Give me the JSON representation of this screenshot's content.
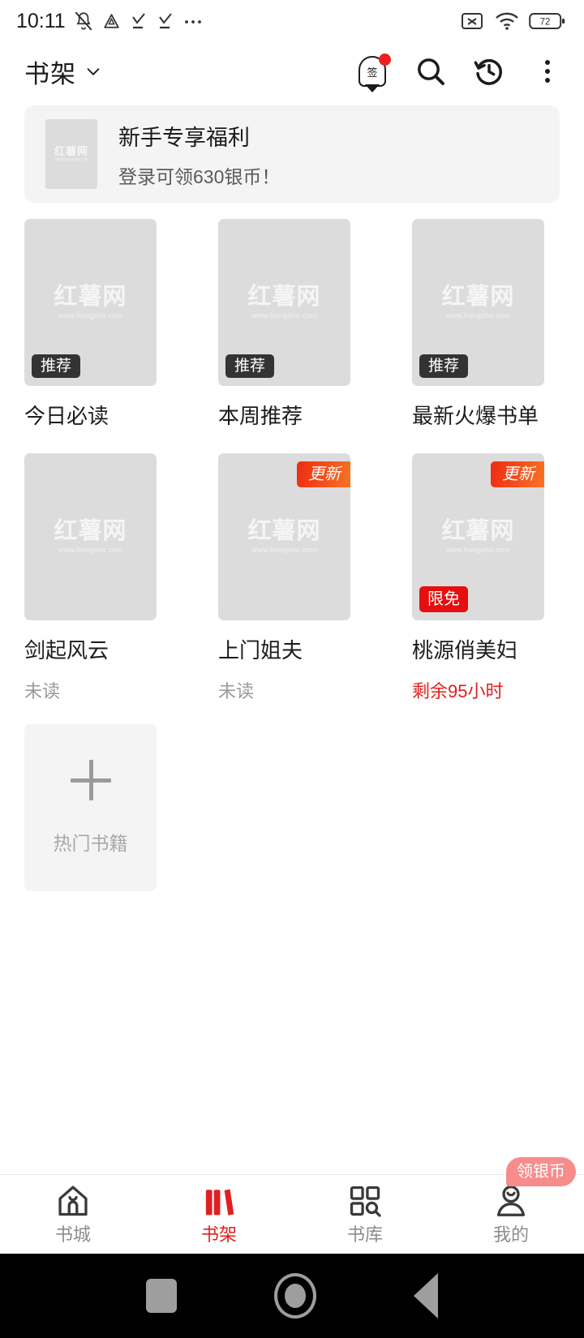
{
  "status_bar": {
    "time": "10:11",
    "battery_percent": "72",
    "icons": [
      "mute-bell-icon",
      "drive-triangle-icon",
      "download-check-icon",
      "download-check-icon",
      "more-dots-icon"
    ],
    "right_icons": [
      "sim-off-icon",
      "wifi-icon",
      "battery-icon"
    ]
  },
  "header": {
    "title": "书架",
    "dropdown_icon": "chevron-down-icon",
    "actions": [
      {
        "name": "sign-in-icon",
        "label": "签",
        "has_dot": true
      },
      {
        "name": "search-icon",
        "label": ""
      },
      {
        "name": "history-icon",
        "label": ""
      },
      {
        "name": "more-menu-icon",
        "label": ""
      }
    ]
  },
  "promo": {
    "title": "新手专享福利",
    "subtitle": "登录可领630银币！",
    "thumb_watermark": {
      "main": "红薯网",
      "url": "www.hongshu.com"
    }
  },
  "watermark": {
    "main": "红薯网",
    "url": "www.hongshu.com"
  },
  "books": [
    {
      "title": "今日必读",
      "status": "",
      "status_type": "none",
      "badge": "推荐",
      "badge_type": "rec",
      "corner": "",
      "cover": "placeholder"
    },
    {
      "title": "本周推荐",
      "status": "",
      "status_type": "none",
      "badge": "推荐",
      "badge_type": "rec",
      "corner": "",
      "cover": "placeholder"
    },
    {
      "title": "最新火爆书单",
      "status": "",
      "status_type": "none",
      "badge": "推荐",
      "badge_type": "rec",
      "corner": "",
      "cover": "placeholder"
    },
    {
      "title": "剑起风云",
      "status": "未读",
      "status_type": "normal",
      "badge": "",
      "badge_type": "none",
      "corner": "",
      "cover": "placeholder"
    },
    {
      "title": "上门姐夫",
      "status": "未读",
      "status_type": "normal",
      "badge": "",
      "badge_type": "none",
      "corner": "更新",
      "cover": "placeholder"
    },
    {
      "title": "桃源俏美妇",
      "status": "剩余95小时",
      "status_type": "warn",
      "badge": "限免",
      "badge_type": "free",
      "corner": "更新",
      "cover": "placeholder"
    }
  ],
  "add_card": {
    "label": "热门书籍",
    "icon": "plus-icon"
  },
  "tabbar": {
    "coin_badge": "领银币",
    "items": [
      {
        "label": "书城",
        "icon": "home-icon",
        "active": false
      },
      {
        "label": "书架",
        "icon": "books-icon",
        "active": true
      },
      {
        "label": "书库",
        "icon": "grid-search-icon",
        "active": false
      },
      {
        "label": "我的",
        "icon": "person-icon",
        "active": false
      }
    ]
  },
  "android_nav": {
    "recents": "square-icon",
    "home": "circle-icon",
    "back": "back-triangle-icon"
  },
  "colors": {
    "accent": "#e02020",
    "badge_dark": "#333333",
    "muted": "#9a9a9a",
    "coin_badge": "#f78c8c"
  }
}
